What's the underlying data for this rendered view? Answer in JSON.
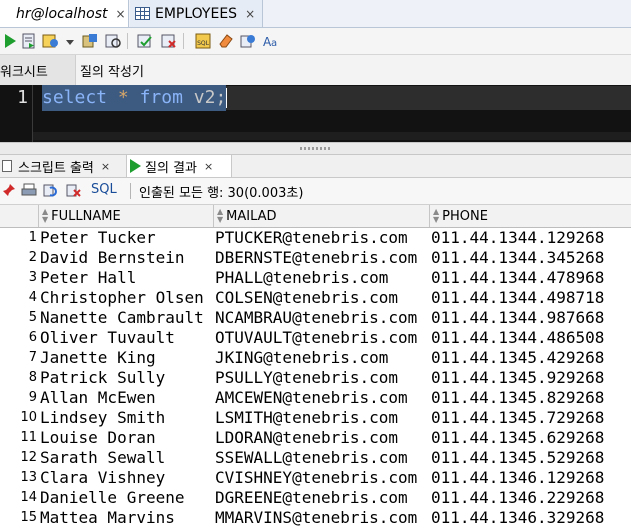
{
  "doc_tabs": [
    {
      "label": "hr@localhost",
      "close": "×"
    },
    {
      "label": "EMPLOYEES",
      "close": "×"
    }
  ],
  "worksheet_tabs": [
    "워크시트",
    "질의 작성기"
  ],
  "editor": {
    "line_number": "1",
    "tokens": {
      "kw1": "select",
      "star": "*",
      "kw2": "from",
      "rest": "v2;"
    }
  },
  "panel_tabs": [
    {
      "label": "스크립트 출력",
      "close": "×"
    },
    {
      "label": "질의 결과",
      "close": "×"
    }
  ],
  "result_toolbar": {
    "sql_label": "SQL",
    "fetch_status": "인출된 모든 행: 30(0.003초)"
  },
  "grid": {
    "columns": [
      "FULLNAME",
      "MAILAD",
      "PHONE"
    ],
    "rows": [
      {
        "n": "1",
        "fullname": "Peter Tucker",
        "mailad": "PTUCKER@tenebris.com",
        "phone": "011.44.1344.129268"
      },
      {
        "n": "2",
        "fullname": "David Bernstein",
        "mailad": "DBERNSTE@tenebris.com",
        "phone": "011.44.1344.345268"
      },
      {
        "n": "3",
        "fullname": "Peter Hall",
        "mailad": "PHALL@tenebris.com",
        "phone": "011.44.1344.478968"
      },
      {
        "n": "4",
        "fullname": "Christopher Olsen",
        "mailad": "COLSEN@tenebris.com",
        "phone": "011.44.1344.498718"
      },
      {
        "n": "5",
        "fullname": "Nanette Cambrault",
        "mailad": "NCAMBRAU@tenebris.com",
        "phone": "011.44.1344.987668"
      },
      {
        "n": "6",
        "fullname": "Oliver Tuvault",
        "mailad": "OTUVAULT@tenebris.com",
        "phone": "011.44.1344.486508"
      },
      {
        "n": "7",
        "fullname": "Janette King",
        "mailad": "JKING@tenebris.com",
        "phone": "011.44.1345.429268"
      },
      {
        "n": "8",
        "fullname": "Patrick Sully",
        "mailad": "PSULLY@tenebris.com",
        "phone": "011.44.1345.929268"
      },
      {
        "n": "9",
        "fullname": "Allan McEwen",
        "mailad": "AMCEWEN@tenebris.com",
        "phone": "011.44.1345.829268"
      },
      {
        "n": "10",
        "fullname": "Lindsey Smith",
        "mailad": "LSMITH@tenebris.com",
        "phone": "011.44.1345.729268"
      },
      {
        "n": "11",
        "fullname": "Louise Doran",
        "mailad": "LDORAN@tenebris.com",
        "phone": "011.44.1345.629268"
      },
      {
        "n": "12",
        "fullname": "Sarath Sewall",
        "mailad": "SSEWALL@tenebris.com",
        "phone": "011.44.1345.529268"
      },
      {
        "n": "13",
        "fullname": "Clara Vishney",
        "mailad": "CVISHNEY@tenebris.com",
        "phone": "011.44.1346.129268"
      },
      {
        "n": "14",
        "fullname": "Danielle Greene",
        "mailad": "DGREENE@tenebris.com",
        "phone": "011.44.1346.229268"
      },
      {
        "n": "15",
        "fullname": "Mattea Marvins",
        "mailad": "MMARVINS@tenebris.com",
        "phone": "011.44.1346.329268"
      }
    ]
  },
  "colors": {
    "editor_bg": "#121212",
    "selection": "#3d5a80",
    "keyword": "#8ab4f8",
    "run_green": "#1e9e2e"
  },
  "icons": [
    "play-icon",
    "run-script-icon",
    "commit-icon",
    "rollback-icon",
    "explain-plan-icon",
    "autotrace-icon",
    "sql-tuning-icon",
    "eraser-icon",
    "history-icon",
    "format-icon",
    "pin-icon",
    "print-icon",
    "refresh-icon",
    "cancel-icon"
  ]
}
